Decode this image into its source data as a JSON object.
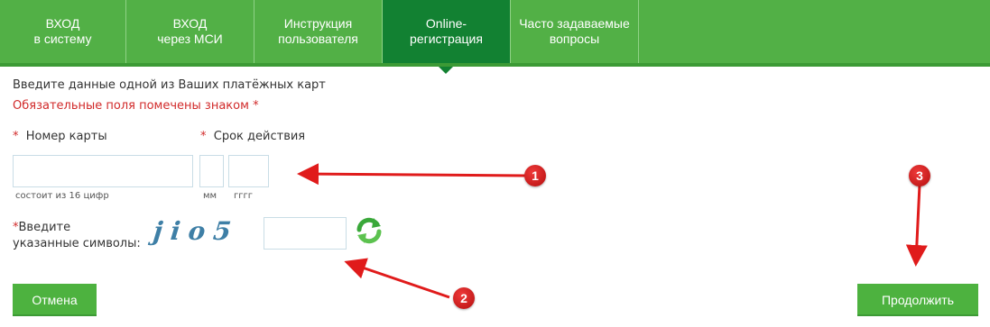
{
  "nav": {
    "tabs": [
      {
        "label": "ВХОД\nв систему",
        "active": false
      },
      {
        "label": "ВХОД\nчерез МСИ",
        "active": false
      },
      {
        "label": "Инструкция\nпользователя",
        "active": false
      },
      {
        "label": "Online-\nрегистрация",
        "active": true
      },
      {
        "label": "Часто задаваемые\nвопросы",
        "active": false
      }
    ]
  },
  "form": {
    "intro": "Введите данные одной из Ваших платёжных карт",
    "required_note": "Обязательные поля помечены знаком",
    "required_mark": "*",
    "card_number": {
      "label": "Номер карты",
      "value": "",
      "hint": "состоит из 16 цифр"
    },
    "expiry": {
      "label": "Срок действия",
      "month": {
        "value": "",
        "hint": "мм"
      },
      "year": {
        "value": "",
        "hint": "гггг"
      }
    },
    "captcha": {
      "label_line1": "Введите",
      "label_line2": "указанные символы:",
      "image_text": "jio5",
      "value": "",
      "refresh_icon": "refresh-icon"
    }
  },
  "buttons": {
    "cancel": "Отмена",
    "continue": "Продолжить"
  },
  "annotations": {
    "markers": [
      "1",
      "2",
      "3"
    ],
    "color": "#e01b1b"
  },
  "colors": {
    "nav_green": "#52b046",
    "nav_active": "#128132",
    "button_green": "#4db23f",
    "required_red": "#d12a2a"
  }
}
